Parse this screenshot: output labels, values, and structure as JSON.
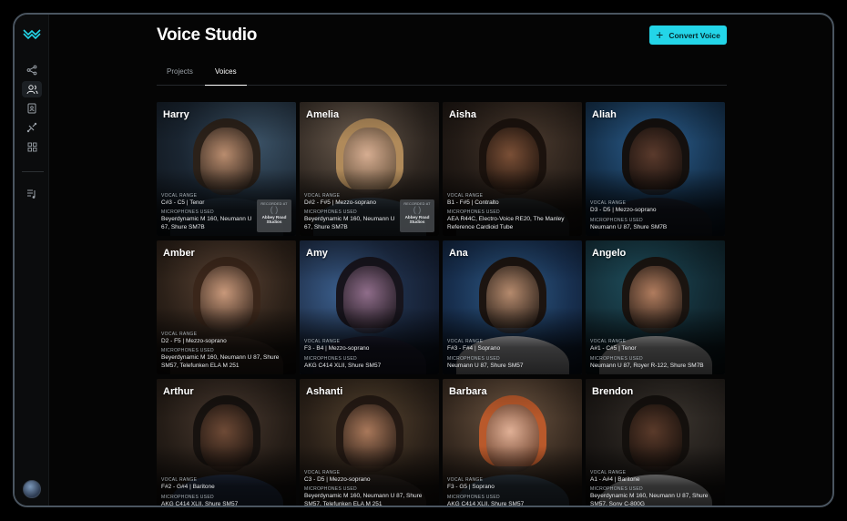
{
  "app": {
    "title": "Voice Studio"
  },
  "header": {
    "convert_button": "Convert Voice"
  },
  "tabs": [
    {
      "label": "Projects",
      "active": false
    },
    {
      "label": "Voices",
      "active": true
    }
  ],
  "sidebar": {
    "icons": [
      "logo-icon",
      "share-icon",
      "users-icon",
      "document-icon",
      "flow-icon",
      "grid-icon",
      "music-list-icon"
    ],
    "active": "users-icon"
  },
  "labels": {
    "vocal_range": "VOCAL RANGE",
    "microphones": "MICROPHONES USED",
    "recorded_at": "RECORDED AT"
  },
  "voices": [
    {
      "name": "Harry",
      "range": "C#3 - C5 | Tenor",
      "mics": "Beyerdynamic M 160, Neumann U 67, Shure SM7B",
      "studio": "Abbey Road Studios"
    },
    {
      "name": "Amelia",
      "range": "D#2 - F#5 | Mezzo-soprano",
      "mics": "Beyerdynamic M 160, Neumann U 67, Shure SM7B",
      "studio": "Abbey Road Studios"
    },
    {
      "name": "Aisha",
      "range": "B1 - F#5 | Contralto",
      "mics": "AEA R44C, Electro-Voice RE20, The Manley Reference Cardioid Tube",
      "studio": ""
    },
    {
      "name": "Aliah",
      "range": "D3 - D5 | Mezzo-soprano",
      "mics": "Neumann U 87, Shure SM7B",
      "studio": ""
    },
    {
      "name": "Amber",
      "range": "D2 - F5 | Mezzo-soprano",
      "mics": "Beyerdynamic M 160, Neumann U 87, Shure SM57, Telefunken ELA M 251",
      "studio": ""
    },
    {
      "name": "Amy",
      "range": "F3 - B4 | Mezzo-soprano",
      "mics": "AKG C414 XLII, Shure SM57",
      "studio": ""
    },
    {
      "name": "Ana",
      "range": "F#3 - F#4 | Soprano",
      "mics": "Neumann U 87, Shure SM57",
      "studio": ""
    },
    {
      "name": "Angelo",
      "range": "A#1 - C#5 | Tenor",
      "mics": "Neumann U 87, Royer R-122, Shure SM7B",
      "studio": ""
    },
    {
      "name": "Arthur",
      "range": "F#2 - G#4 | Baritone",
      "mics": "AKG C414 XLII, Shure SM57",
      "studio": ""
    },
    {
      "name": "Ashanti",
      "range": "C3 - D5 | Mezzo-soprano",
      "mics": "Beyerdynamic M 160, Neumann U 87, Shure SM57, Telefunken ELA M 251",
      "studio": ""
    },
    {
      "name": "Barbara",
      "range": "F3 - G5 | Soprano",
      "mics": "AKG C414 XLII, Shure SM57",
      "studio": ""
    },
    {
      "name": "Brendon",
      "range": "A1 - A#4 | Baritone",
      "mics": "Beyerdynamic M 160, Neumann U 87, Shure SM57, Sony C-800G",
      "studio": ""
    }
  ],
  "colors": {
    "accent": "#23d5e8",
    "background": "#050505",
    "frame_border": "#4a5560"
  }
}
